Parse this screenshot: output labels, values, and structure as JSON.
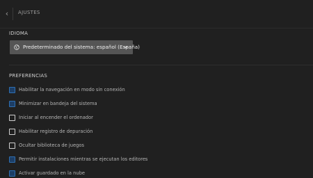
{
  "header": {
    "back_icon": "chevron-left-icon",
    "breadcrumb": "AJUSTES"
  },
  "language": {
    "section_title": "IDIOMA",
    "selected_value": "Predeterminado del sistema: español (España)",
    "icon": "globe-icon",
    "dropdown_icon": "chevron-down-icon"
  },
  "preferences": {
    "section_title": "PREFERENCIAS",
    "options": [
      {
        "label": "Habilitar la navegación en modo sin conexión",
        "checked": true
      },
      {
        "label": "Minimizar en bandeja del sistema",
        "checked": true
      },
      {
        "label": "Iniciar al encender el ordenador",
        "checked": false
      },
      {
        "label": "Habilitar registro de depuración",
        "checked": false
      },
      {
        "label": "Ocultar biblioteca de juegos",
        "checked": false
      },
      {
        "label": "Permitir instalaciones mientras se ejecutan los editores",
        "checked": true
      },
      {
        "label": "Activar guardado en la nube",
        "checked": true
      }
    ]
  },
  "colors": {
    "background": "#202020",
    "select_bg": "#555555",
    "checkbox_checked": "#2e6fb3"
  }
}
